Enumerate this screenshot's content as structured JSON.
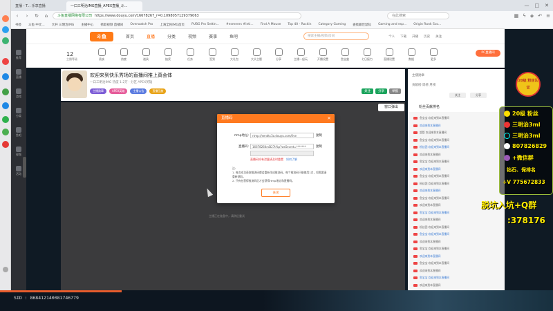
{
  "browser": {
    "tabs": [
      "直播 - T... 乐享直播",
      "一口三明治IMG直播_APEX直播_斗..."
    ],
    "url_site": "斗鱼直播网络有限公司",
    "url": "https://www.douyu.com/16678267_r=0.1098057129379063",
    "search_placeholder": "在此搜索",
    "bookmarks": [
      "书签",
      "斗鱼 中文...",
      "大开 三明治IMG",
      "主播中心",
      "抓取视频 直播间",
      "Overwatch Pro",
      "上海全民IMG首页",
      "PUBG Pro Settin...",
      "#esmeers #inti...",
      "Find A Mouse",
      "Top 40 - Rockin",
      "Category Gaming",
      "查找最佳鼠标",
      "Gaming and esp...",
      "Origin Rank Sco..."
    ]
  },
  "douyu": {
    "logo": "斗鱼",
    "nav": [
      "首页",
      "直播",
      "分类",
      "视频",
      "赛事",
      "鱼吧"
    ],
    "search_placeholder": "搜索主播/视频/房间",
    "header_icons": [
      "个人",
      "下载",
      "开播",
      "历史",
      "关注"
    ],
    "sidebar": [
      "推荐",
      "直播",
      "游戏",
      "分类",
      "鱼吧",
      "视频",
      "活动",
      "社区"
    ],
    "level": "12",
    "level_label": "主播等级",
    "tools": [
      "贵族",
      "热度",
      "道具",
      "抽奖",
      "任务",
      "签到",
      "大礼包",
      "大头主题",
      "分享",
      "主播一起玩",
      "开播设置",
      "鱼宝盒",
      "七日接力",
      "直播设置",
      "数据",
      "更多"
    ],
    "pc_button": "PC直播间",
    "room_title": "欢迎来到快乐秀场的直播间推上真会体",
    "room_meta": "一口三明治IMG   热度 1.2万  · 分区 APEX英雄",
    "tags": [
      "主播勋章",
      "APEX英雄",
      "主播公告",
      "直播回放"
    ],
    "room_actions": [
      "关注",
      "分享",
      "举报"
    ],
    "exit_button": "窗口弹出",
    "video_hint": "主播正在准备中，请稍后重试",
    "right_top": {
      "row1": "主播勋章",
      "row2": "贡献榜 周榜 月榜",
      "btn1": "关注",
      "btn2": "分享"
    },
    "chat_header": "粉丝贡献排名",
    "chat_rows": [
      "鱼宝宝 欢迎来到本直播间",
      "欢迎来到本直播间",
      "超管 欢迎来到本直播间",
      "鱼宝宝 欢迎来到本直播间",
      "粉丝团 欢迎来到本直播间",
      "欢迎来到本直播间",
      "鱼宝宝 欢迎来到本直播间",
      "欢迎来到本直播间",
      "鱼宝宝 欢迎来到本直播间",
      "粉丝团 欢迎来到本直播间",
      "欢迎来到本直播间",
      "鱼宝宝 欢迎来到本直播间",
      "欢迎来到本直播间",
      "鱼宝宝 欢迎来到本直播间",
      "欢迎来到本直播间",
      "粉丝团 欢迎来到本直播间",
      "鱼宝宝 欢迎来到本直播间",
      "欢迎来到本直播间",
      "鱼宝宝 欢迎来到本直播间",
      "欢迎来到本直播间",
      "鱼宝宝 欢迎来到本直播间",
      "欢迎来到本直播间",
      "鱼宝宝 欢迎来到本直播间",
      "欢迎来到本直播间"
    ]
  },
  "modal": {
    "title": "直播码",
    "close": "×",
    "rtmp_label": "rtmp地址:",
    "rtmp_value": "rtmp://sendtc3a.douyu.com/live",
    "code_label": "直播码:",
    "code_value": "16678264rsD27t%p?wsSecret=*******",
    "copy": "复制",
    "copy2": "复制",
    "warn": "直播码如有泄露请及时重置",
    "link": "如何了解",
    "notes_head": "注:",
    "notes": [
      "1. 每次成功获取推流码都会重新生成推流码。每个推流码只能使用1次，如需要请重新获取。",
      "2. 只有在获得推流码后才会获得rtmp地址和直播码。"
    ],
    "ok": "关闭"
  },
  "overlay": {
    "badge": "20级 粉丝认证",
    "rows": [
      "20级 粉丝",
      "三明治3ml",
      "三明治3ml",
      "807826829",
      "+微信群",
      "钻石、保排名",
      "+V 775672833"
    ],
    "big": "脱坑入坑+Q群",
    "num": ":378176"
  },
  "bottom": {
    "sid": "SID : 868412140081746779",
    "progress": 0.22
  },
  "colors": {
    "accent": "#ff7a20",
    "overlay_text": "#ffeb00",
    "warn": "#e4393c"
  }
}
